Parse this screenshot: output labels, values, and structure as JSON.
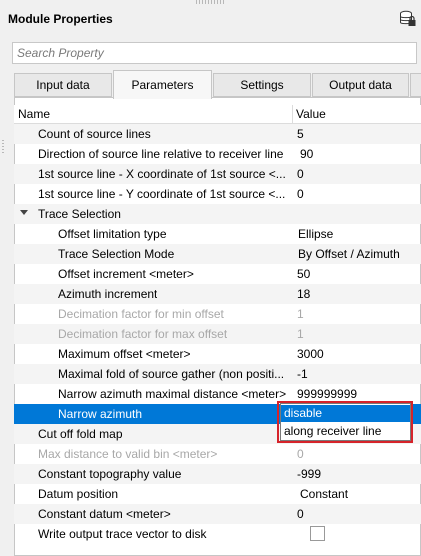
{
  "window": {
    "title": "Module Properties",
    "db_icon": "database-lock-icon"
  },
  "search": {
    "placeholder": "Search Property"
  },
  "tabs": [
    {
      "label": "Input data"
    },
    {
      "label": "Parameters"
    },
    {
      "label": "Settings"
    },
    {
      "label": "Output data"
    }
  ],
  "table": {
    "columns": {
      "name": "Name",
      "value": "Value"
    },
    "rows": [
      {
        "name": "Count of source lines",
        "value": "5"
      },
      {
        "name": "Direction of source line relative to receiver line",
        "value": "90"
      },
      {
        "name": "1st source line - X coordinate of 1st source <...",
        "value": "0"
      },
      {
        "name": "1st source line - Y coordinate of 1st source <...",
        "value": "0"
      },
      {
        "name": "Trace Selection",
        "value": ""
      },
      {
        "name": "Offset limitation type",
        "value": "Ellipse"
      },
      {
        "name": "Trace Selection Mode",
        "value": "By Offset / Azimuth"
      },
      {
        "name": "Offset increment <meter>",
        "value": "50"
      },
      {
        "name": "Azimuth increment",
        "value": "18"
      },
      {
        "name": "Decimation factor for min offset",
        "value": "1"
      },
      {
        "name": "Decimation factor for max offset",
        "value": "1"
      },
      {
        "name": "Maximum offset <meter>",
        "value": "3000"
      },
      {
        "name": "Maximal fold of source gather (non positi...",
        "value": "-1"
      },
      {
        "name": "Narrow azimuth maximal distance <meter>",
        "value": "999999999"
      },
      {
        "name": "Narrow azimuth",
        "value": "disable"
      },
      {
        "name": "Cut off fold map",
        "value": ""
      },
      {
        "name": "Max distance to valid bin <meter>",
        "value": "0"
      },
      {
        "name": "Constant topography value",
        "value": "-999"
      },
      {
        "name": "Datum position",
        "value": "Constant"
      },
      {
        "name": "Constant datum <meter>",
        "value": "0"
      },
      {
        "name": "Write output trace vector to disk",
        "value": ""
      }
    ]
  },
  "dropdown": {
    "options": [
      "disable",
      "along receiver line"
    ],
    "highlighted": "disable"
  }
}
